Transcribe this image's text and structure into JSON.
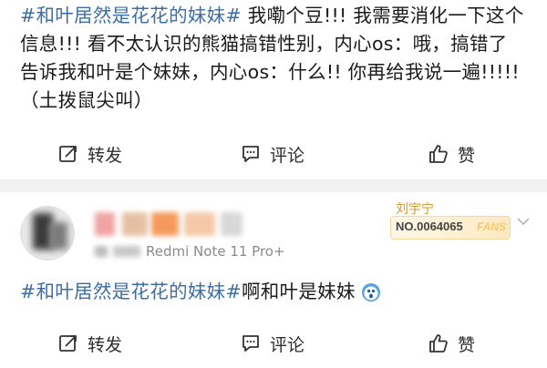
{
  "post1": {
    "hashtag": "#和叶居然是花花的妹妹#",
    "body": " 我嘞个豆!!! 我需要消化一下这个信息!!! 看不太认识的熊猫搞错性别，内心os：哦，搞错了 告诉我和叶是个妹妹，内心os：什么!! 你再给我说一遍!!!!!（土拨鼠尖叫）",
    "actions": {
      "repost": "转发",
      "comment": "评论",
      "like": "赞"
    }
  },
  "post2": {
    "device": "Redmi Note 11 Pro+",
    "fan_badge": {
      "name": "刘宇宁",
      "number": "NO.0064065",
      "tag": "FANS"
    },
    "hashtag": "#和叶居然是花花的妹妹#",
    "body": " 啊和叶是妹妹",
    "emoji": "scared-face-emoji",
    "actions": {
      "repost": "转发",
      "comment": "评论",
      "like": "赞"
    }
  },
  "colors": {
    "hashtag": "#3b6ea5",
    "text": "#1a1a1a",
    "divider": "#f2f2f2",
    "fan_gold": "#d49a2c"
  }
}
